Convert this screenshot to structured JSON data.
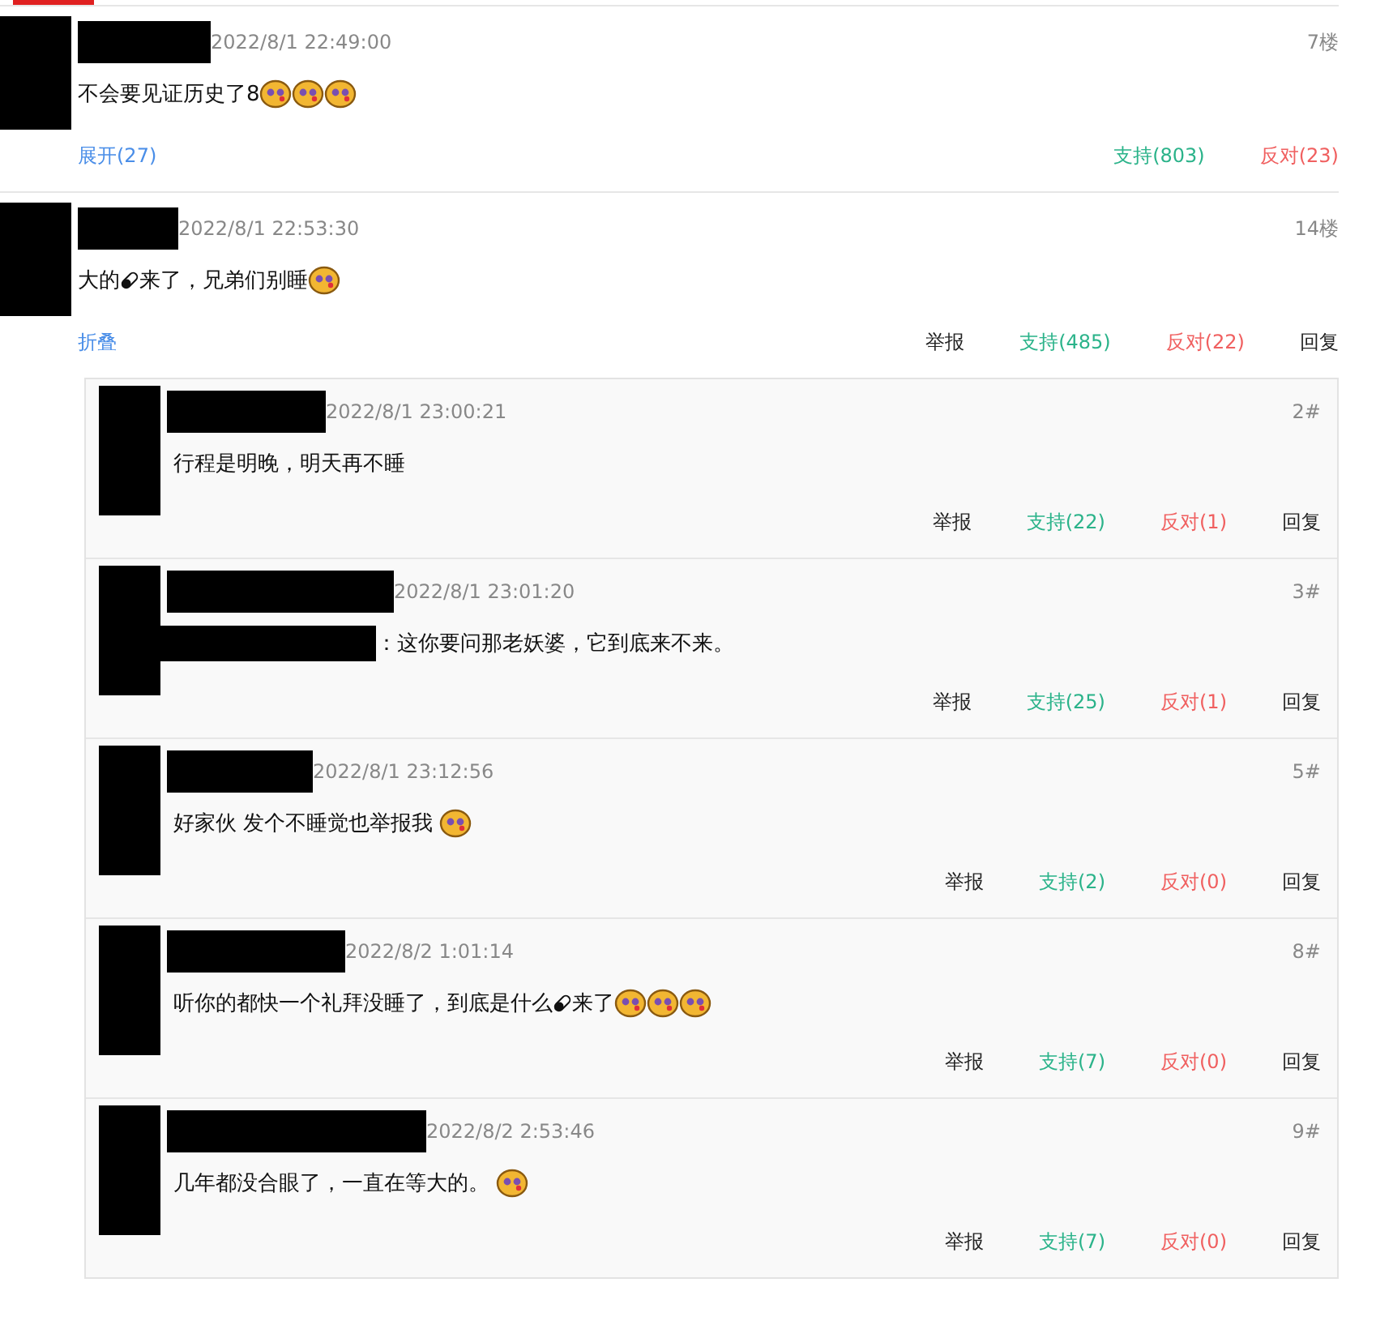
{
  "comments": [
    {
      "time": "2022/8/1 22:49:00",
      "floor": "7楼",
      "content": [
        {
          "kind": "text",
          "text": "不会要见证历史了8"
        },
        {
          "kind": "emoji"
        },
        {
          "kind": "emoji"
        },
        {
          "kind": "emoji"
        }
      ],
      "actions": [
        {
          "kind": "toggle",
          "label": "展开(27)"
        },
        {
          "kind": "support",
          "label": "支持(803)"
        },
        {
          "kind": "oppose",
          "label": "反对(23)"
        }
      ]
    },
    {
      "time": "2022/8/1 22:53:30",
      "floor": "14楼",
      "content": [
        {
          "kind": "text",
          "text": "大的"
        },
        {
          "kind": "pill"
        },
        {
          "kind": "text",
          "text": "来了，兄弟们别睡"
        },
        {
          "kind": "emoji"
        }
      ],
      "actions": [
        {
          "kind": "toggle",
          "label": "折叠"
        },
        {
          "kind": "report",
          "label": "举报"
        },
        {
          "kind": "support",
          "label": "支持(485)"
        },
        {
          "kind": "oppose",
          "label": "反对(22)"
        },
        {
          "kind": "reply",
          "label": "回复"
        }
      ],
      "replies": [
        {
          "time": "2022/8/1 23:00:21",
          "floor": "2#",
          "content": [
            {
              "kind": "text",
              "text": "行程是明晚，明天再不睡"
            }
          ],
          "actions": [
            {
              "kind": "report",
              "label": "举报"
            },
            {
              "kind": "support",
              "label": "支持(22)"
            },
            {
              "kind": "oppose",
              "label": "反对(1)"
            },
            {
              "kind": "reply",
              "label": "回复"
            }
          ]
        },
        {
          "time": "2022/8/1 23:01:20",
          "floor": "3#",
          "content": [
            {
              "kind": "redaction"
            },
            {
              "kind": "text",
              "text": "：这你要问那老妖婆，它到底来不来。"
            }
          ],
          "actions": [
            {
              "kind": "report",
              "label": "举报"
            },
            {
              "kind": "support",
              "label": "支持(25)"
            },
            {
              "kind": "oppose",
              "label": "反对(1)"
            },
            {
              "kind": "reply",
              "label": "回复"
            }
          ]
        },
        {
          "time": "2022/8/1 23:12:56",
          "floor": "5#",
          "content": [
            {
              "kind": "text",
              "text": "好家伙 发个不睡觉也举报我 "
            },
            {
              "kind": "emoji"
            }
          ],
          "actions": [
            {
              "kind": "report",
              "label": "举报"
            },
            {
              "kind": "support",
              "label": "支持(2)"
            },
            {
              "kind": "oppose",
              "label": "反对(0)"
            },
            {
              "kind": "reply",
              "label": "回复"
            }
          ]
        },
        {
          "time": "2022/8/2 1:01:14",
          "floor": "8#",
          "content": [
            {
              "kind": "text",
              "text": "听你的都快一个礼拜没睡了，到底是什么"
            },
            {
              "kind": "pill"
            },
            {
              "kind": "text",
              "text": "来了"
            },
            {
              "kind": "emoji"
            },
            {
              "kind": "emoji"
            },
            {
              "kind": "emoji"
            }
          ],
          "actions": [
            {
              "kind": "report",
              "label": "举报"
            },
            {
              "kind": "support",
              "label": "支持(7)"
            },
            {
              "kind": "oppose",
              "label": "反对(0)"
            },
            {
              "kind": "reply",
              "label": "回复"
            }
          ]
        },
        {
          "time": "2022/8/2 2:53:46",
          "floor": "9#",
          "content": [
            {
              "kind": "text",
              "text": "几年都没合眼了，一直在等大的。 "
            },
            {
              "kind": "emoji"
            }
          ],
          "actions": [
            {
              "kind": "report",
              "label": "举报"
            },
            {
              "kind": "support",
              "label": "支持(7)"
            },
            {
              "kind": "oppose",
              "label": "反对(0)"
            },
            {
              "kind": "reply",
              "label": "回复"
            }
          ]
        }
      ]
    }
  ]
}
